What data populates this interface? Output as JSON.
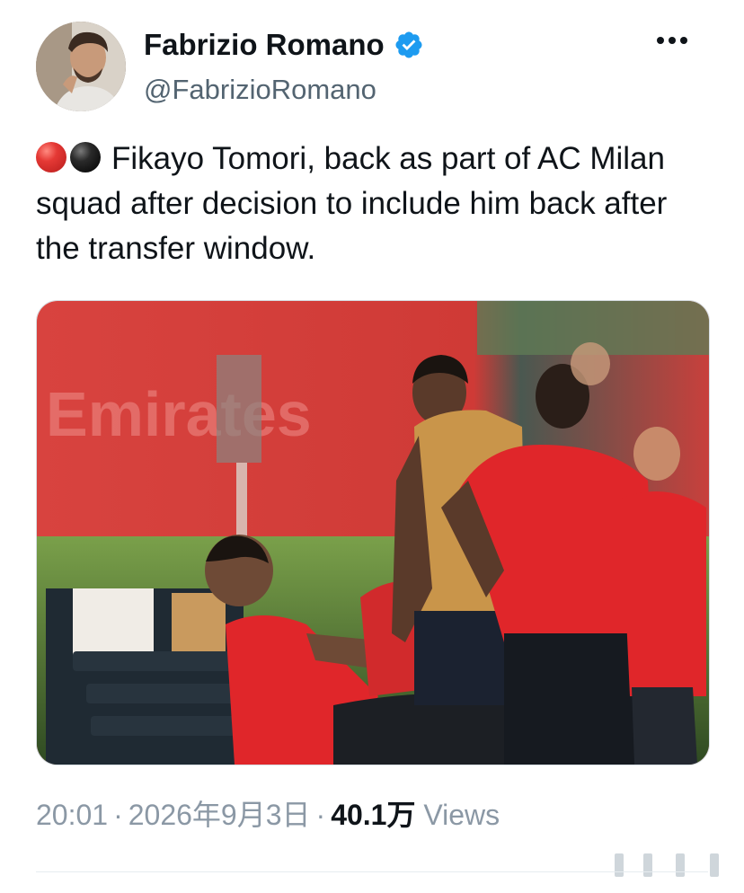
{
  "author": {
    "display_name": "Fabrizio Romano",
    "handle": "@FabrizioRomano",
    "verified": true,
    "avatar_icon": "profile-photo"
  },
  "menu": {
    "more_icon": "ellipsis-icon"
  },
  "tweet": {
    "emoji": [
      "red-circle",
      "black-circle"
    ],
    "text": "Fikayo Tomori, back as part of AC Milan squad after decision to include him back after the transfer window."
  },
  "media": {
    "type": "photo",
    "description_icon": "training-photo"
  },
  "meta": {
    "time": "20:01",
    "date": "2026年9月3日",
    "views_count": "40.1万",
    "views_label": "Views",
    "separator": "·"
  },
  "colors": {
    "verified": "#1d9bf0",
    "muted": "#8b98a5",
    "text": "#0f1419",
    "milan_red": "#e0262a"
  }
}
